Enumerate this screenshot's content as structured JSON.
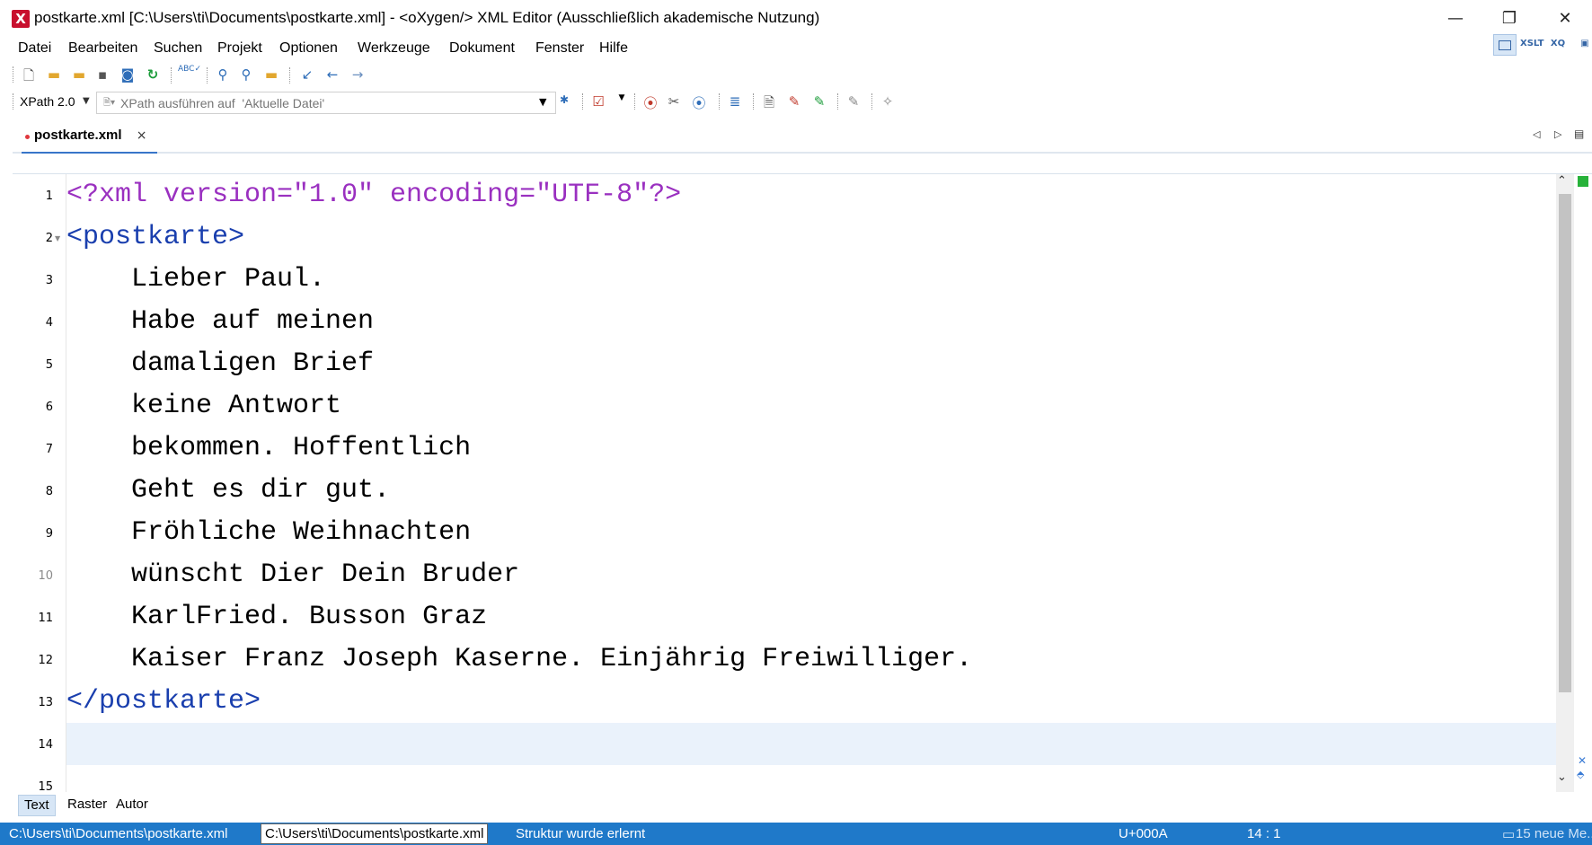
{
  "window": {
    "title": "postkarte.xml [C:\\Users\\ti\\Documents\\postkarte.xml] - <oXygen/> XML Editor (Ausschließlich akademische Nutzung)",
    "app_icon": "X",
    "controls": {
      "minimize": "—",
      "maximize": "❐",
      "close": "✕"
    }
  },
  "menu": [
    "Datei",
    "Bearbeiten",
    "Suchen",
    "Projekt",
    "Optionen",
    "Werkzeuge",
    "Dokument",
    "Fenster",
    "Hilfe"
  ],
  "perspectives": [
    "XSLT",
    "XQ"
  ],
  "toolbar": {
    "icons": [
      "new-file-icon",
      "open-folder-icon",
      "open-url-icon",
      "save-icon",
      "save-all-icon",
      "reload-icon",
      "spellcheck-icon",
      "find-icon",
      "find-in-files-icon",
      "open-in-browser-icon",
      "last-edit-icon",
      "back-icon",
      "forward-icon"
    ]
  },
  "xpath": {
    "version": "XPath 2.0",
    "placeholder": "XPath ausführen auf  'Aktuelle Datei'"
  },
  "tab": {
    "label": "postkarte.xml",
    "close": "×"
  },
  "editor": {
    "lines": [
      {
        "n": "1",
        "parts": [
          {
            "t": "<?xml version=\"1.0\" encoding=\"UTF-8\"?>",
            "c": "pi"
          }
        ]
      },
      {
        "n": "2",
        "parts": [
          {
            "t": "<postkarte>",
            "c": "tag"
          }
        ]
      },
      {
        "n": "3",
        "parts": [
          {
            "t": "    Lieber Paul.",
            "c": "txt"
          }
        ]
      },
      {
        "n": "4",
        "parts": [
          {
            "t": "    Habe auf meinen",
            "c": "txt"
          }
        ]
      },
      {
        "n": "5",
        "parts": [
          {
            "t": "    damaligen Brief",
            "c": "txt"
          }
        ]
      },
      {
        "n": "6",
        "parts": [
          {
            "t": "    keine Antwort",
            "c": "txt"
          }
        ]
      },
      {
        "n": "7",
        "parts": [
          {
            "t": "    bekommen. Hoffentlich",
            "c": "txt"
          }
        ]
      },
      {
        "n": "8",
        "parts": [
          {
            "t": "    Geht es dir gut.",
            "c": "txt"
          }
        ]
      },
      {
        "n": "9",
        "parts": [
          {
            "t": "    Fröhliche Weihnachten",
            "c": "txt"
          }
        ]
      },
      {
        "n": "10",
        "parts": [
          {
            "t": "    wünscht Dier Dein Bruder",
            "c": "txt"
          }
        ]
      },
      {
        "n": "11",
        "parts": [
          {
            "t": "    KarlFried. Busson Graz",
            "c": "txt"
          }
        ]
      },
      {
        "n": "12",
        "parts": [
          {
            "t": "    Kaiser Franz Joseph Kaserne. Einjährig Freiwilliger.",
            "c": "txt"
          }
        ]
      },
      {
        "n": "13",
        "parts": [
          {
            "t": "</postkarte>",
            "c": "tag"
          }
        ]
      },
      {
        "n": "14",
        "parts": []
      },
      {
        "n": "15",
        "parts": []
      }
    ]
  },
  "modes": [
    "Text",
    "Raster",
    "Autor"
  ],
  "status": {
    "path": "C:\\Users\\ti\\Documents\\postkarte.xml",
    "path_tooltip": "C:\\Users\\ti\\Documents\\postkarte.xml",
    "message": "Struktur wurde erlernt",
    "unicode": "U+000A",
    "position": "14 : 1",
    "notifications": "15 neue Me..."
  },
  "colors": {
    "processing_instruction": "#9a30c0",
    "tag": "#1a3fae",
    "status_bar": "#1f79c9"
  }
}
